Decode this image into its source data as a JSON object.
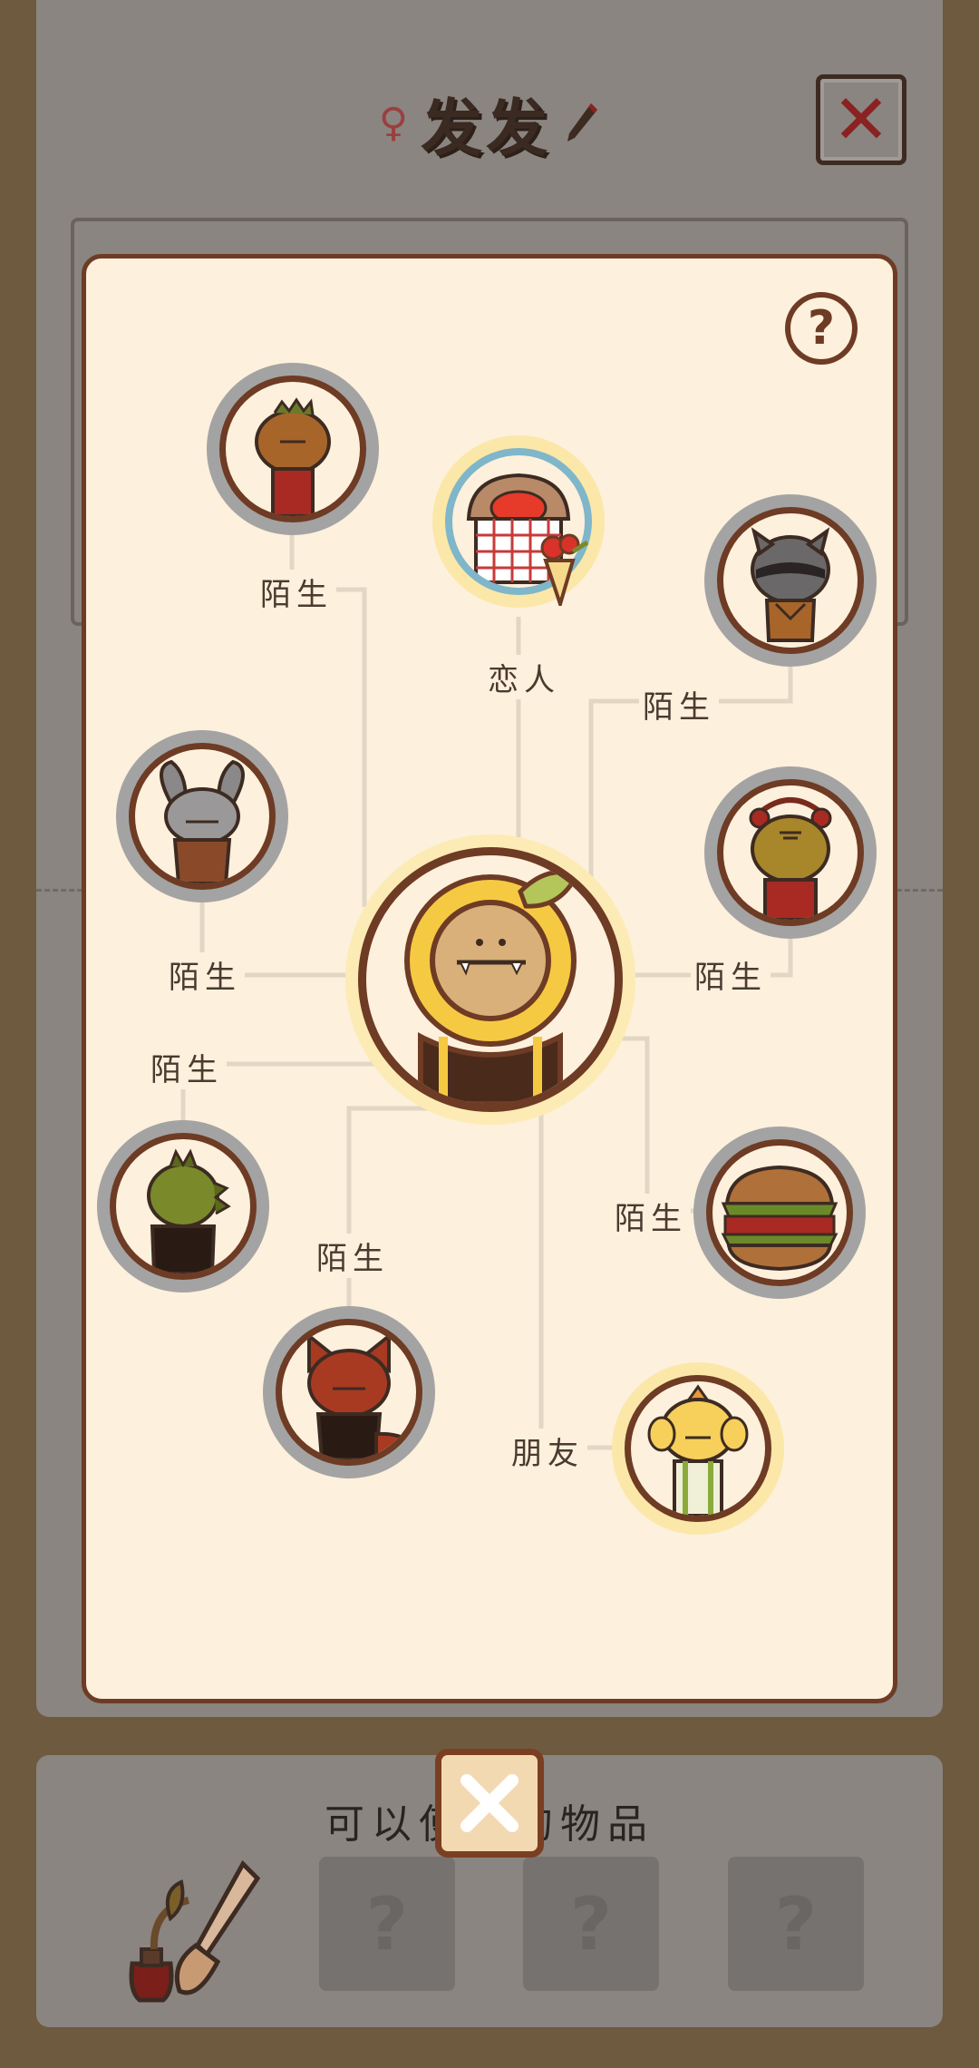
{
  "profile": {
    "gender_symbol": "♀",
    "name": "发发",
    "edit_icon": "pencil-icon",
    "close_icon": "close-icon"
  },
  "items_panel": {
    "title": "可以使用的物品",
    "tool_icon": "shovel-and-watering-pot-icon",
    "locked_slots": [
      "?",
      "?",
      "?"
    ]
  },
  "relationship_map": {
    "help_label": "?",
    "center": {
      "name": "sunflower-character"
    },
    "relations": [
      {
        "id": "pinecone",
        "label": "陌生",
        "icon": "pinecone-character-icon"
      },
      {
        "id": "lover",
        "label": "恋人",
        "icon": "rose-bouquet-character-icon"
      },
      {
        "id": "raccoon",
        "label": "陌生",
        "icon": "raccoon-character-icon"
      },
      {
        "id": "rabbit",
        "label": "陌生",
        "icon": "rabbit-character-icon"
      },
      {
        "id": "tiger",
        "label": "陌生",
        "icon": "tiger-character-icon"
      },
      {
        "id": "dino",
        "label": "陌生",
        "icon": "dinosaur-character-icon"
      },
      {
        "id": "burger",
        "label": "陌生",
        "icon": "burger-character-icon"
      },
      {
        "id": "fox",
        "label": "陌生",
        "icon": "fox-character-icon"
      },
      {
        "id": "chick",
        "label": "朋友",
        "icon": "chick-character-icon"
      }
    ]
  },
  "modal_close_icon": "close-icon",
  "colors": {
    "frame_brown": "#6e3b24",
    "modal_bg": "#fdf0dc",
    "stranger_ring": "#a3a3a3",
    "friend_ring": "#fbe7a8",
    "lover_ring": "#7fb6c9",
    "line": "#e2d6c4"
  }
}
